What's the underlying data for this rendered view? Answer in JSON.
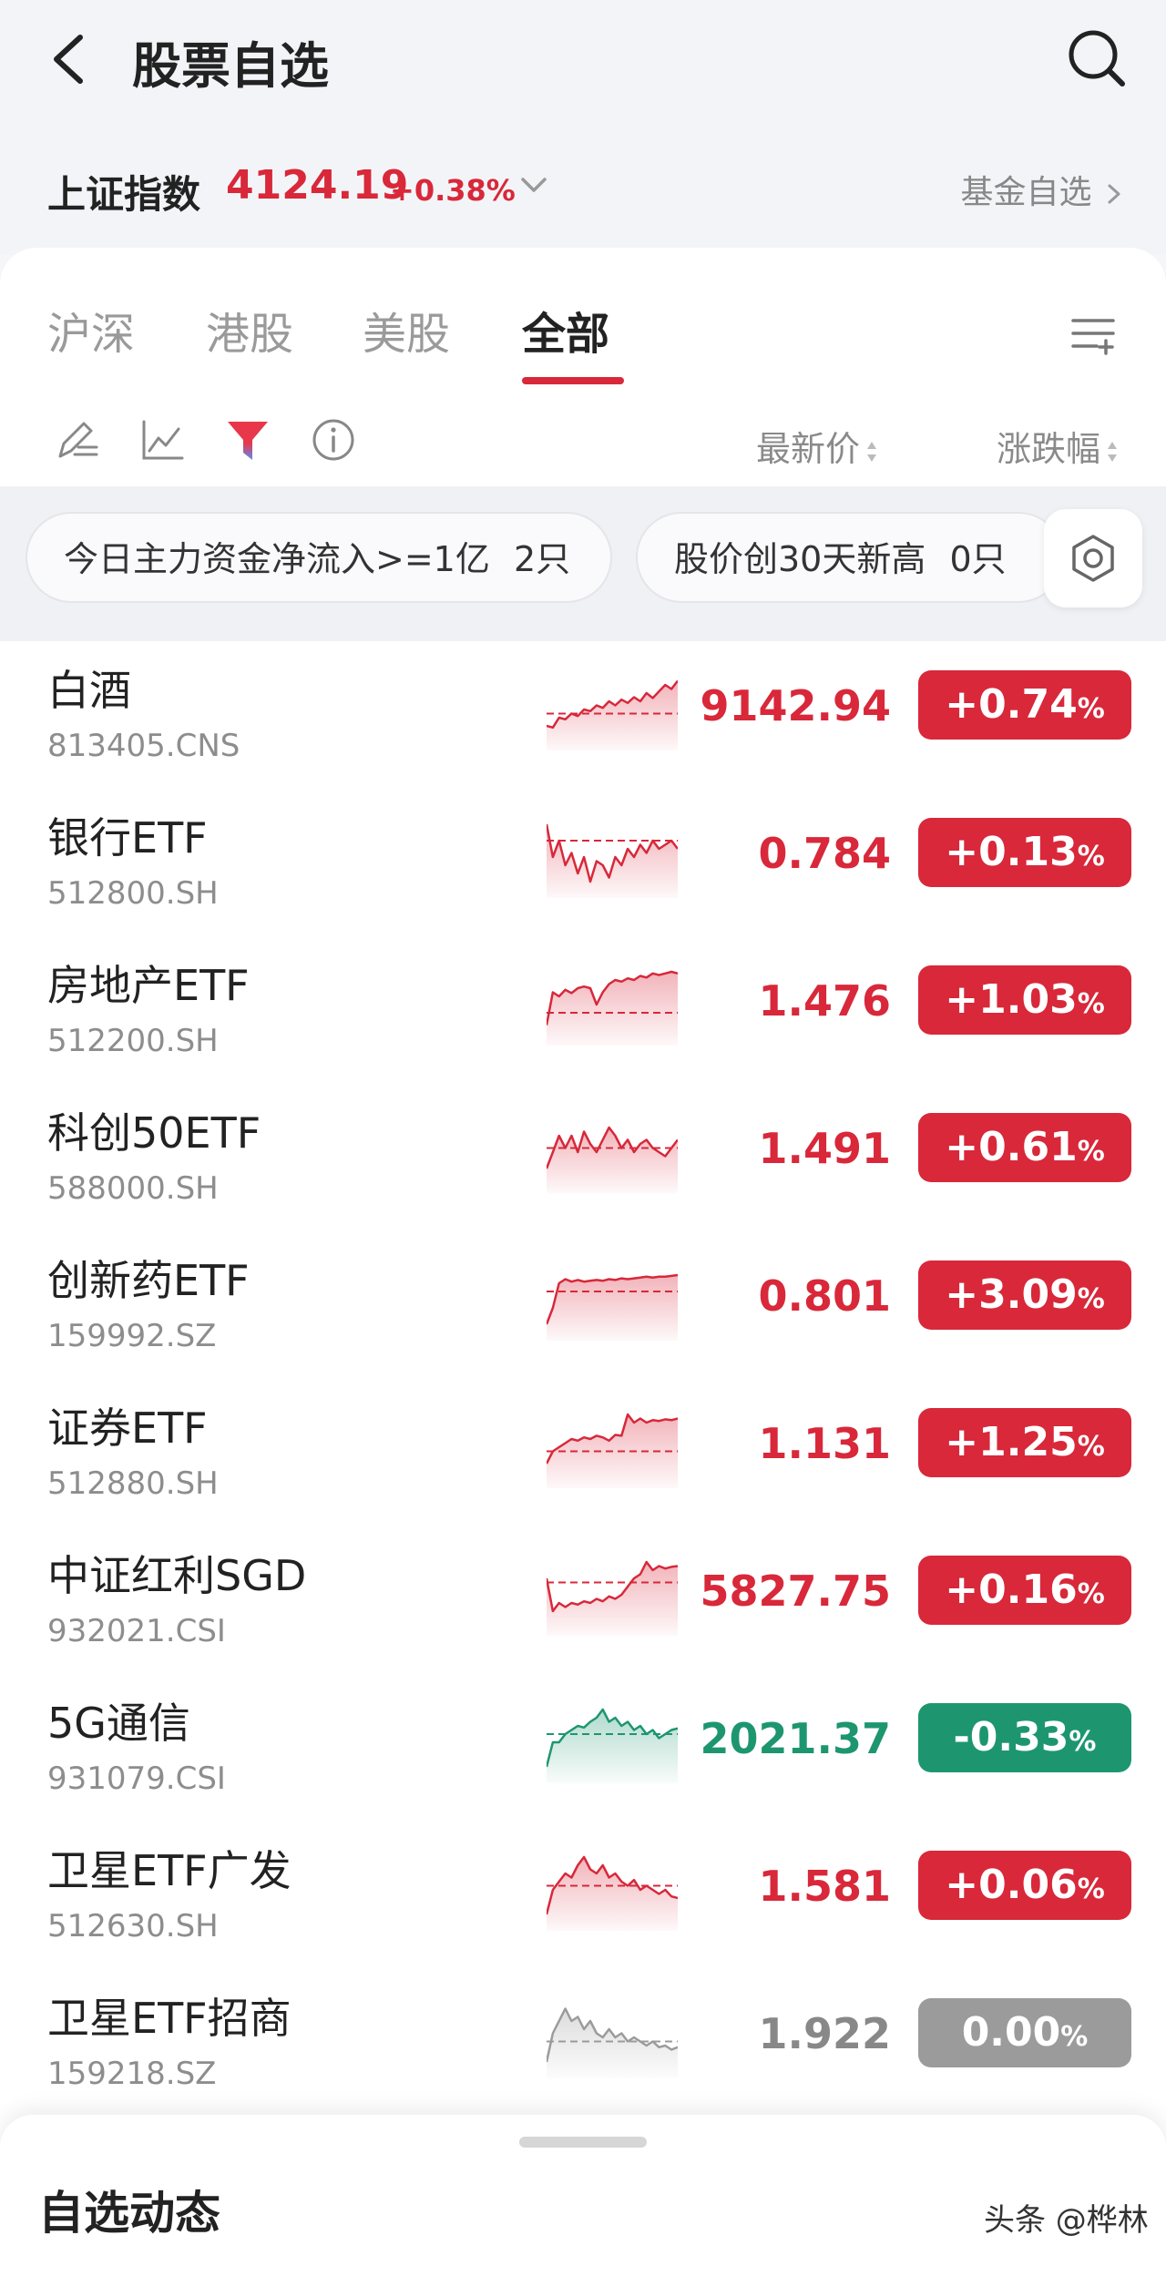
{
  "header": {
    "title": "股票自选",
    "back_icon": "chevron-left-icon",
    "search_icon": "search-icon"
  },
  "index": {
    "name": "上证指数",
    "value": "4124.19",
    "change": "+0.38%",
    "fund_link": "基金自选"
  },
  "tabs": [
    {
      "label": "沪深",
      "active": false
    },
    {
      "label": "港股",
      "active": false
    },
    {
      "label": "美股",
      "active": false
    },
    {
      "label": "全部",
      "active": true
    }
  ],
  "columns": {
    "price": "最新价",
    "change": "涨跌幅"
  },
  "filters": [
    {
      "label": "今日主力资金净流入>=1亿",
      "count": "2只"
    },
    {
      "label": "股价创30天新高",
      "count": "0只"
    }
  ],
  "colors": {
    "up": "#d8283a",
    "down": "#1d9670",
    "flat": "#9b9b9b"
  },
  "stocks": [
    {
      "name": "白酒",
      "code": "813405.CNS",
      "price": "9142.94",
      "change": "+0.74",
      "trend": "up"
    },
    {
      "name": "银行ETF",
      "code": "512800.SH",
      "price": "0.784",
      "change": "+0.13",
      "trend": "up"
    },
    {
      "name": "房地产ETF",
      "code": "512200.SH",
      "price": "1.476",
      "change": "+1.03",
      "trend": "up"
    },
    {
      "name": "科创50ETF",
      "code": "588000.SH",
      "price": "1.491",
      "change": "+0.61",
      "trend": "up"
    },
    {
      "name": "创新药ETF",
      "code": "159992.SZ",
      "price": "0.801",
      "change": "+3.09",
      "trend": "up"
    },
    {
      "name": "证券ETF",
      "code": "512880.SH",
      "price": "1.131",
      "change": "+1.25",
      "trend": "up"
    },
    {
      "name": "中证红利SGD",
      "code": "932021.CSI",
      "price": "5827.75",
      "change": "+0.16",
      "trend": "up"
    },
    {
      "name": "5G通信",
      "code": "931079.CSI",
      "price": "2021.37",
      "change": "-0.33",
      "trend": "down"
    },
    {
      "name": "卫星ETF广发",
      "code": "512630.SH",
      "price": "1.581",
      "change": "+0.06",
      "trend": "up"
    },
    {
      "name": "卫星ETF招商",
      "code": "159218.SZ",
      "price": "1.922",
      "change": "0.00",
      "trend": "flat"
    }
  ],
  "pct_unit": "%",
  "bottom": {
    "title": "自选动态",
    "watermark": "头条 @桦林"
  }
}
